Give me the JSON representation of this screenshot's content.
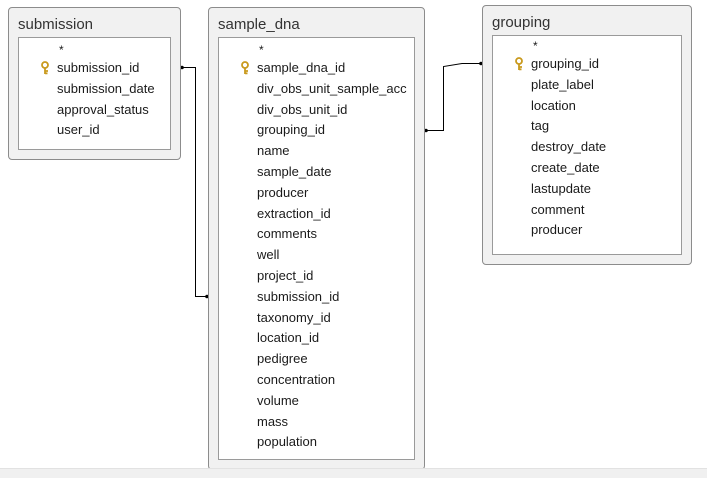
{
  "colors": {
    "frame": "#f1f1f1",
    "frame_border": "#8c8c8c",
    "panel": "#ffffff",
    "line": "#000000",
    "key": "#c99a1e"
  },
  "tables": [
    {
      "id": "submission",
      "title": "submission",
      "fields": [
        {
          "name": "*",
          "primary_key": false
        },
        {
          "name": "submission_id",
          "primary_key": true
        },
        {
          "name": "submission_date",
          "primary_key": false
        },
        {
          "name": "approval_status",
          "primary_key": false
        },
        {
          "name": "user_id",
          "primary_key": false
        }
      ]
    },
    {
      "id": "sample_dna",
      "title": "sample_dna",
      "fields": [
        {
          "name": "*",
          "primary_key": false
        },
        {
          "name": "sample_dna_id",
          "primary_key": true
        },
        {
          "name": "div_obs_unit_sample_acc",
          "primary_key": false
        },
        {
          "name": "div_obs_unit_id",
          "primary_key": false
        },
        {
          "name": "grouping_id",
          "primary_key": false
        },
        {
          "name": "name",
          "primary_key": false
        },
        {
          "name": "sample_date",
          "primary_key": false
        },
        {
          "name": "producer",
          "primary_key": false
        },
        {
          "name": "extraction_id",
          "primary_key": false
        },
        {
          "name": "comments",
          "primary_key": false
        },
        {
          "name": "well",
          "primary_key": false
        },
        {
          "name": "project_id",
          "primary_key": false
        },
        {
          "name": "submission_id",
          "primary_key": false
        },
        {
          "name": "taxonomy_id",
          "primary_key": false
        },
        {
          "name": "location_id",
          "primary_key": false
        },
        {
          "name": "pedigree",
          "primary_key": false
        },
        {
          "name": "concentration",
          "primary_key": false
        },
        {
          "name": "volume",
          "primary_key": false
        },
        {
          "name": "mass",
          "primary_key": false
        },
        {
          "name": "population",
          "primary_key": false
        }
      ]
    },
    {
      "id": "grouping",
      "title": "grouping",
      "fields": [
        {
          "name": "*",
          "primary_key": false
        },
        {
          "name": "grouping_id",
          "primary_key": true
        },
        {
          "name": "plate_label",
          "primary_key": false
        },
        {
          "name": "location",
          "primary_key": false
        },
        {
          "name": "tag",
          "primary_key": false
        },
        {
          "name": "destroy_date",
          "primary_key": false
        },
        {
          "name": "create_date",
          "primary_key": false
        },
        {
          "name": "lastupdate",
          "primary_key": false
        },
        {
          "name": "comment",
          "primary_key": false
        },
        {
          "name": "producer",
          "primary_key": false
        }
      ]
    }
  ],
  "relationships": [
    {
      "from_table": "submission",
      "from_field": "submission_id",
      "to_table": "sample_dna",
      "to_field": "submission_id"
    },
    {
      "from_table": "grouping",
      "from_field": "grouping_id",
      "to_table": "sample_dna",
      "to_field": "grouping_id"
    }
  ]
}
